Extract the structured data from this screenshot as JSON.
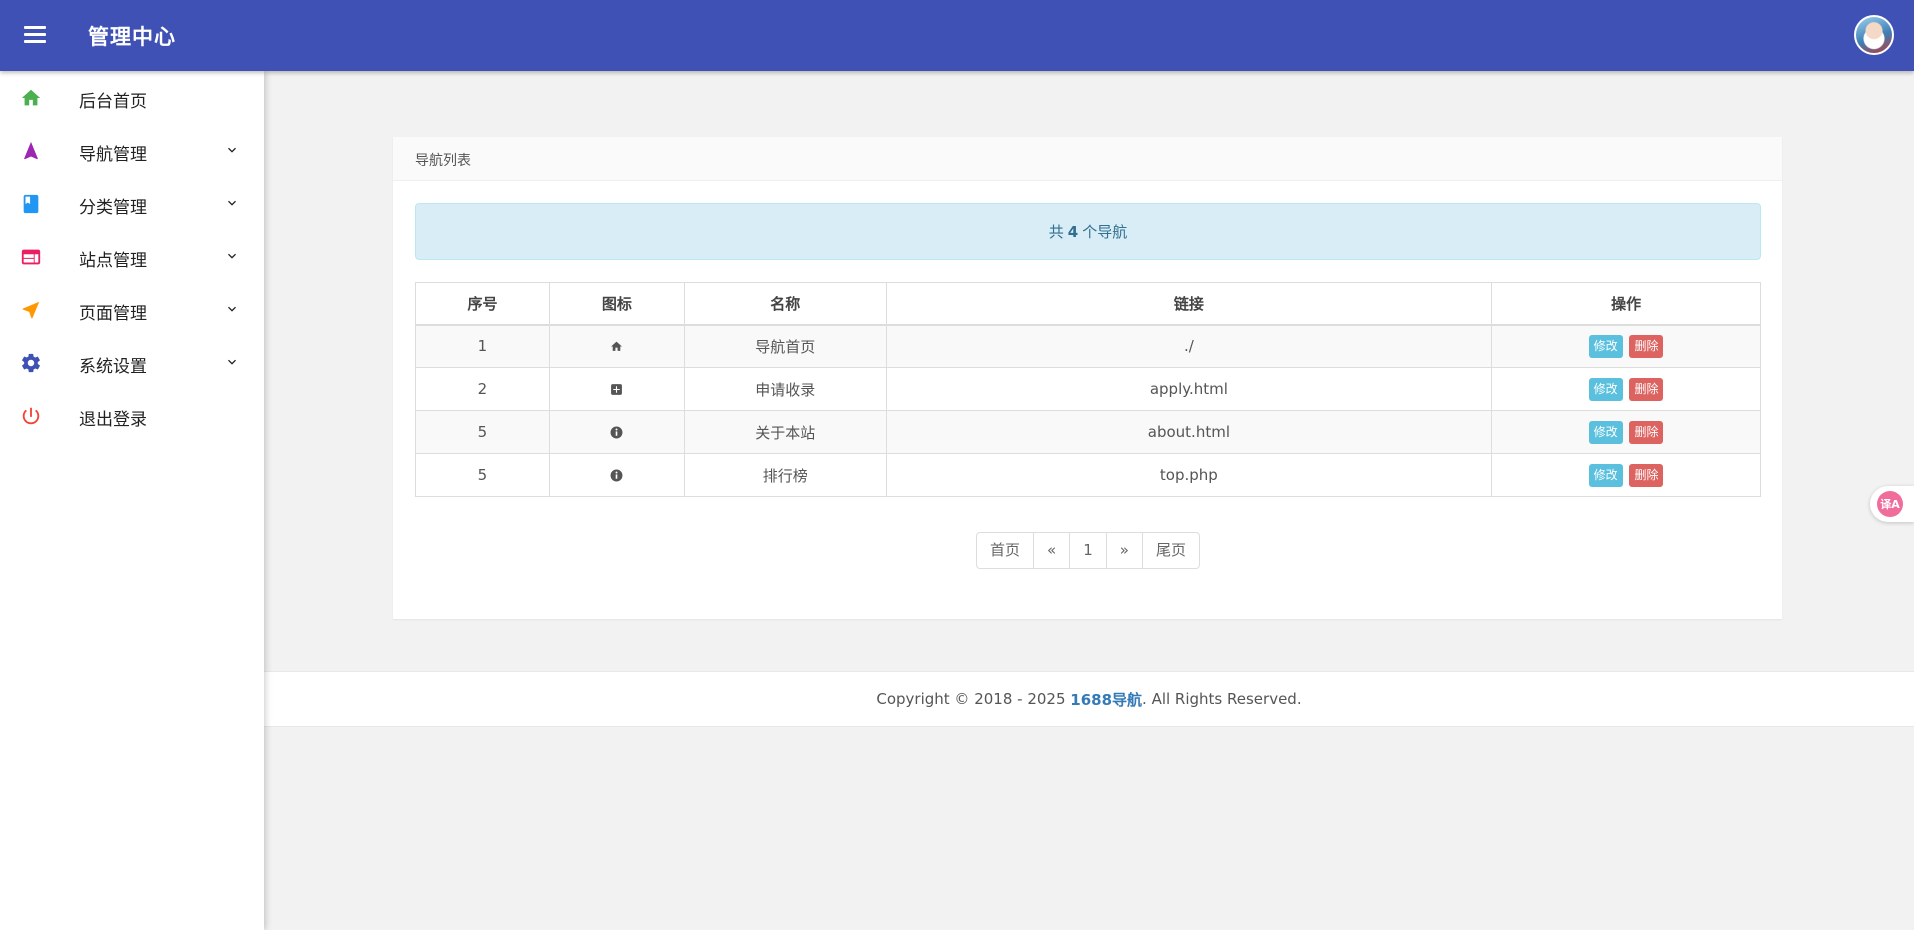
{
  "header": {
    "title": "管理中心",
    "menu_icon": "menu-icon",
    "avatar": "user-avatar"
  },
  "sidebar": {
    "items": [
      {
        "label": "后台首页",
        "icon": "home-icon",
        "color": "#4caf50"
      },
      {
        "label": "导航管理",
        "icon": "navigation-icon",
        "color": "#9c27b0"
      },
      {
        "label": "分类管理",
        "icon": "book-icon",
        "color": "#2196f3"
      },
      {
        "label": "站点管理",
        "icon": "web-icon",
        "color": "#e91e63"
      },
      {
        "label": "页面管理",
        "icon": "send-icon",
        "color": "#ff9800"
      },
      {
        "label": "系统设置",
        "icon": "gear-icon",
        "color": "#3f51b5"
      },
      {
        "label": "退出登录",
        "icon": "power-icon",
        "color": "#f44336"
      }
    ]
  },
  "card": {
    "title": "导航列表",
    "notice": {
      "prefix": "共",
      "count": "4",
      "suffix": "个导航"
    }
  },
  "table": {
    "headers": [
      "序号",
      "图标",
      "名称",
      "链接",
      "操作"
    ],
    "rows": [
      {
        "id": "1",
        "icon": "home-icon",
        "name": "导航首页",
        "link": "./"
      },
      {
        "id": "2",
        "icon": "plus-square-icon",
        "name": "申请收录",
        "link": "apply.html"
      },
      {
        "id": "5",
        "icon": "info-icon",
        "name": "关于本站",
        "link": "about.html"
      },
      {
        "id": "5",
        "icon": "info-icon",
        "name": "排行榜",
        "link": "top.php"
      }
    ],
    "edit_label": "修改",
    "delete_label": "删除"
  },
  "pager": {
    "first": "首页",
    "prev": "«",
    "page": "1",
    "next": "»",
    "last": "尾页"
  },
  "footer": {
    "prefix": "Copyright © 2018 - 2025 ",
    "brand": "1688导航",
    "suffix": ". All Rights Reserved."
  },
  "translate_widget": "译A",
  "colors": {
    "header": "#3f51b5",
    "edit": "#5bc0de",
    "delete": "#d9534f",
    "notice_bg": "#d9edf7"
  }
}
